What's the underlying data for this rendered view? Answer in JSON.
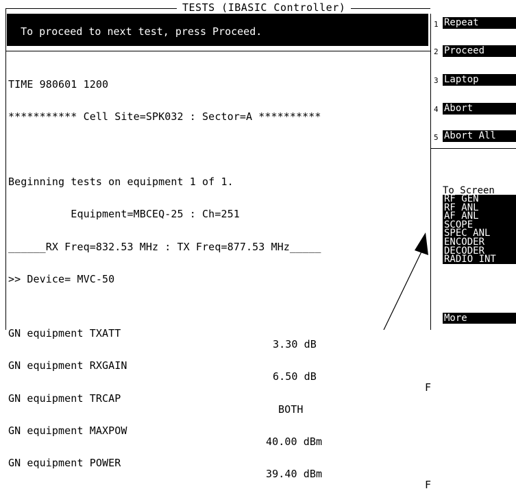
{
  "window": {
    "title": "TESTS (IBASIC Controller)"
  },
  "message": {
    "text": "To proceed to next test, press Proceed."
  },
  "output": {
    "time": "TIME 980601 1200",
    "cell_site": "*********** Cell Site=SPK032 : Sector=A **********",
    "blank": "",
    "beginning": "Beginning tests on equipment 1 of 1.",
    "equipment": "          Equipment=MBCEQ-25 : Ch=251",
    "freq": "______RX Freq=832.53 MHz : TX Freq=877.53 MHz_____",
    "device": ">> Device= MVC-50",
    "results": [
      {
        "name": "GN equipment TXATT",
        "value": "3.30 dB",
        "flag": ""
      },
      {
        "name": "GN equipment RXGAIN",
        "value": "6.50 dB",
        "flag": "F"
      },
      {
        "name": "GN equipment TRCAP",
        "value": "BOTH",
        "flag": ""
      },
      {
        "name": "GN equipment MAXPOW",
        "value": "40.00 dBm",
        "flag": ""
      },
      {
        "name": "GN equipment POWER",
        "value": "39.40 dBm",
        "flag": "F"
      }
    ]
  },
  "softkeys": [
    {
      "num": "1",
      "label": "Repeat"
    },
    {
      "num": "2",
      "label": "Proceed"
    },
    {
      "num": "3",
      "label": "Laptop"
    },
    {
      "num": "4",
      "label": "Abort"
    },
    {
      "num": "5",
      "label": "Abort All"
    }
  ],
  "screens": {
    "heading": "To Screen",
    "items": [
      "RF GEN",
      "RF ANL",
      "AF ANL",
      "SCOPE",
      "SPEC ANL",
      "ENCODER",
      "DECODER",
      "RADIO INT"
    ],
    "more": "More"
  },
  "annotation": {
    "icon": "arrow-icon"
  }
}
